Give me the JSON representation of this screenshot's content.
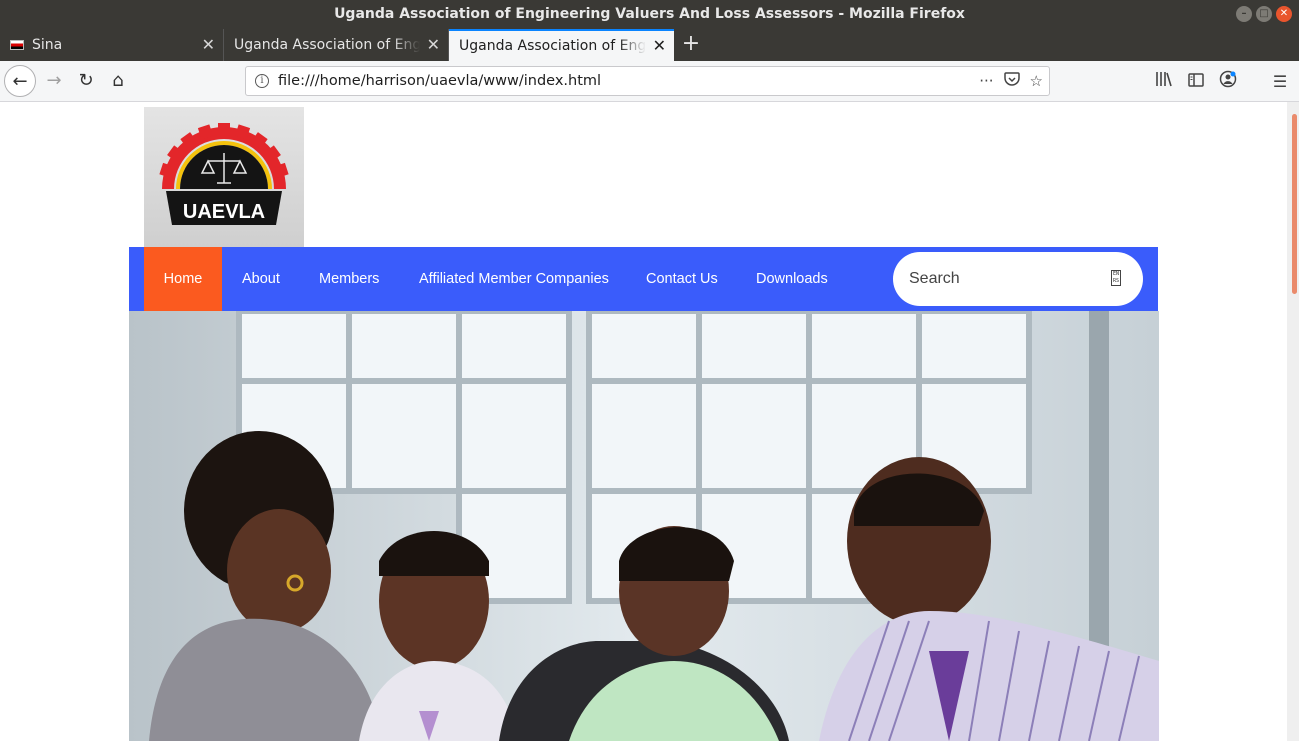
{
  "window": {
    "title": "Uganda Association of Engineering Valuers And Loss Assessors - Mozilla Firefox",
    "controls": [
      "minimize",
      "maximize",
      "close"
    ]
  },
  "tabs": [
    {
      "label": "Sina",
      "icon": "ug-flag-icon",
      "active": false
    },
    {
      "label": "Uganda Association of Engineering Valuers And Loss Assessors",
      "active": false
    },
    {
      "label": "Uganda Association of Engineering Valuers And Loss Assessors",
      "active": true
    }
  ],
  "toolbar": {
    "url": "file:///home/harrison/uaevla/www/index.html",
    "page_actions_icon": "···"
  },
  "site": {
    "logo_text": "UAEVLA",
    "nav": [
      {
        "label": "Home",
        "active": true
      },
      {
        "label": "About"
      },
      {
        "label": "Members"
      },
      {
        "label": "Affiliated Member Companies"
      },
      {
        "label": "Contact Us"
      },
      {
        "label": "Downloads"
      }
    ],
    "search": {
      "placeholder": "Search",
      "button_glyph": "EN RS"
    }
  },
  "colors": {
    "nav_background": "#3a5cfb",
    "nav_active": "#fb5a1f",
    "titlebar": "#3a3935"
  }
}
